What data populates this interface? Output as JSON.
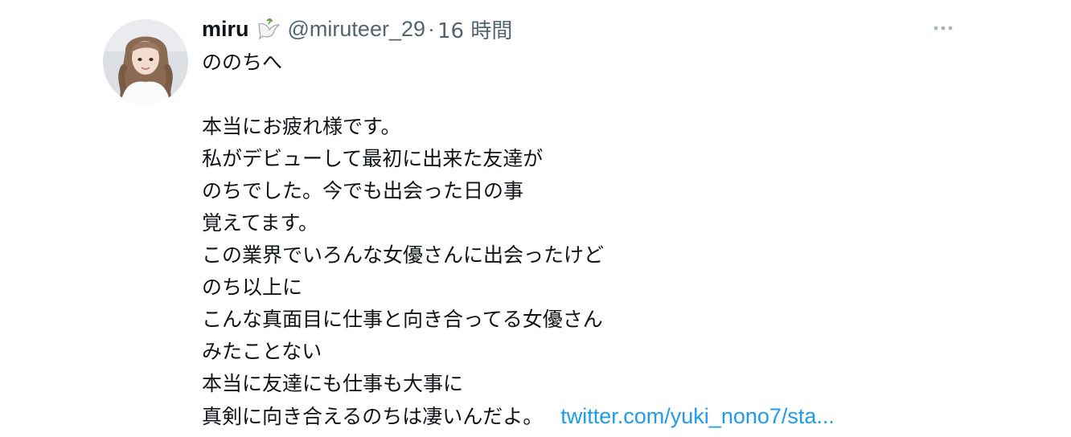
{
  "tweet": {
    "display_name": "miru",
    "badge_icon": "dove-icon",
    "handle": "@miruteer_29",
    "separator": "·",
    "time": "16 時間",
    "more_icon": "more-options-icon",
    "lines": [
      "ののちへ",
      "",
      "本当にお疲れ様です。",
      "私がデビューして最初に出来た友達が",
      "のちでした。今でも出会った日の事",
      "覚えてます。",
      "この業界でいろんな女優さんに出会ったけど",
      "のち以上に",
      "こんな真面目に仕事と向き合ってる女優さん",
      "みたことない",
      "本当に友達にも仕事も大事に",
      "真剣に向き合えるのちは凄いんだよ。"
    ],
    "link_text": "twitter.com/yuki_nono7/sta...",
    "colors": {
      "text": "#0f1419",
      "secondary": "#536471",
      "link": "#1d9bf0"
    }
  }
}
